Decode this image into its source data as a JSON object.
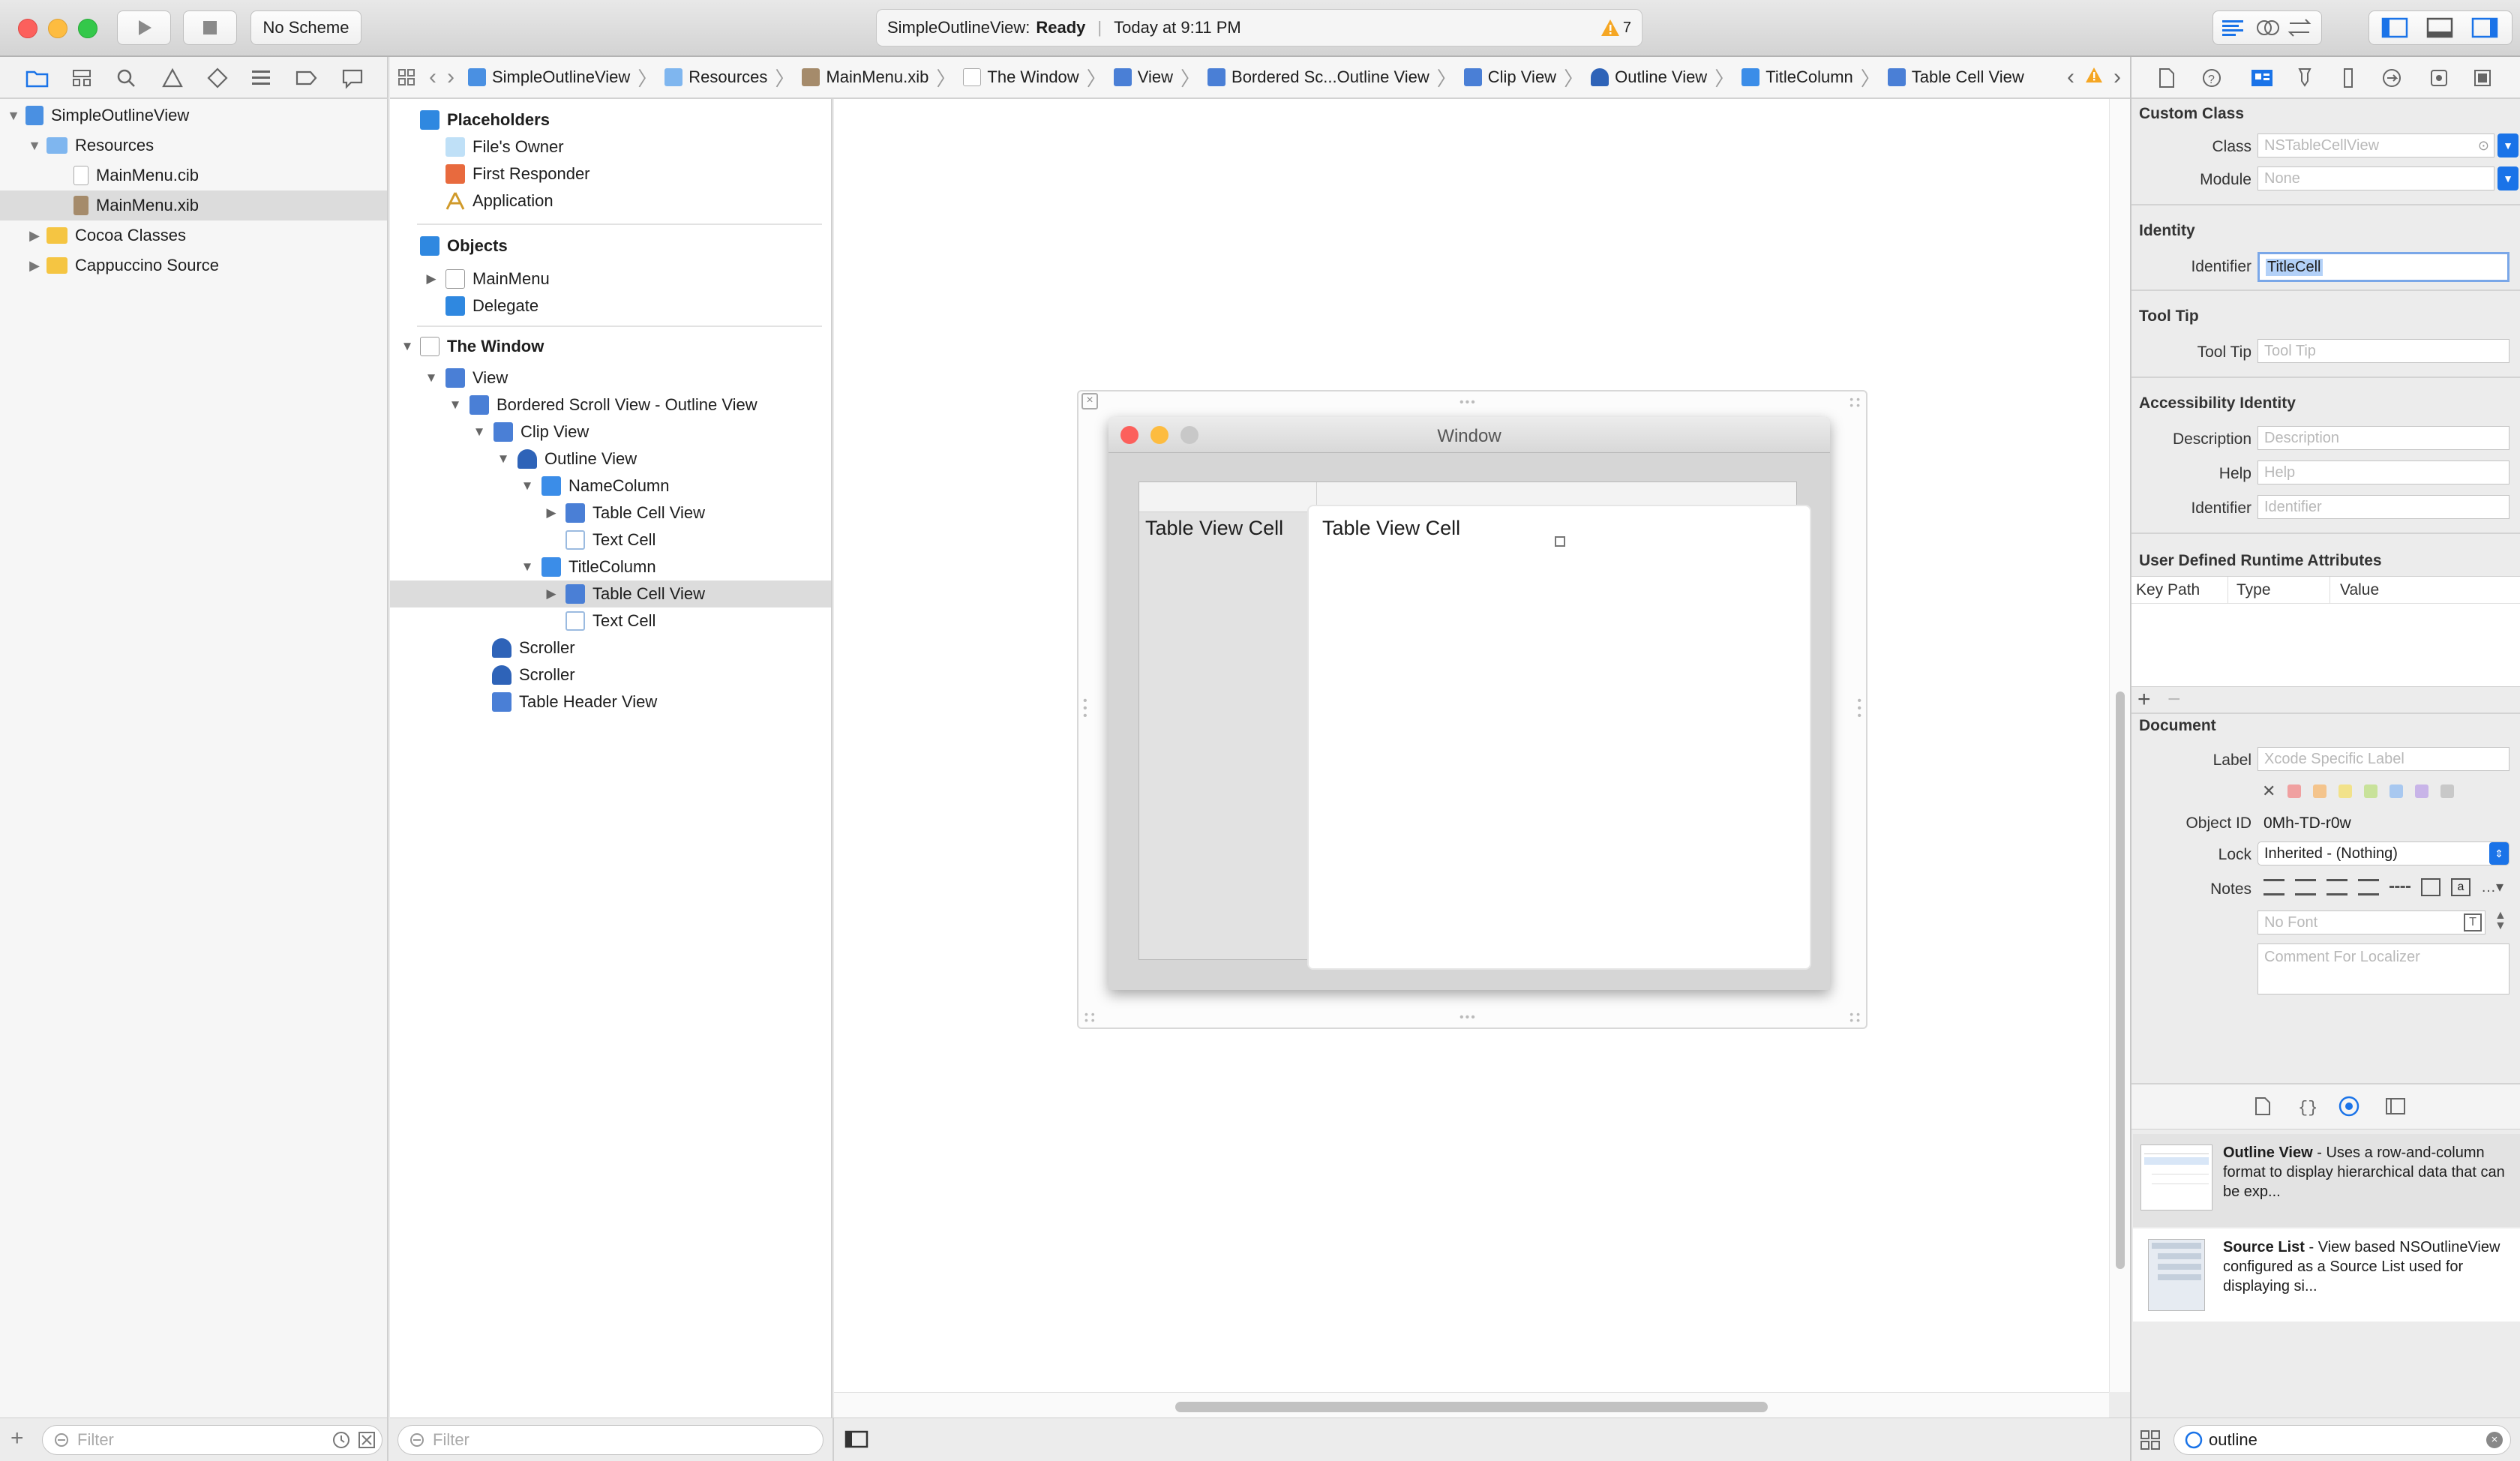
{
  "toolbar": {
    "scheme": "No Scheme",
    "activity_title": "SimpleOutlineView:",
    "activity_status": "Ready",
    "activity_time": "Today at 9:11 PM",
    "warning_count": "7"
  },
  "jumpbar": {
    "crumbs": [
      "SimpleOutlineView",
      "Resources",
      "MainMenu.xib",
      "The Window",
      "View",
      "Bordered Sc...Outline View",
      "Clip View",
      "Outline View",
      "TitleColumn",
      "Table Cell View"
    ]
  },
  "navigator": {
    "items": [
      {
        "label": "SimpleOutlineView"
      },
      {
        "label": "Resources"
      },
      {
        "label": "MainMenu.cib"
      },
      {
        "label": "MainMenu.xib"
      },
      {
        "label": "Cocoa Classes"
      },
      {
        "label": "Cappuccino Source"
      }
    ],
    "filter_placeholder": "Filter"
  },
  "outline": {
    "placeholders_title": "Placeholders",
    "placeholders": [
      "File's Owner",
      "First Responder",
      "Application"
    ],
    "objects_title": "Objects",
    "objects": [
      "MainMenu",
      "Delegate"
    ],
    "window_title": "The Window",
    "tree": [
      "View",
      "Bordered Scroll View - Outline View",
      "Clip View",
      "Outline View",
      "NameColumn",
      "Table Cell View",
      "Text Cell",
      "TitleColumn",
      "Table Cell View",
      "Text Cell",
      "Scroller",
      "Scroller",
      "Table Header View"
    ],
    "filter_placeholder": "Filter"
  },
  "canvas": {
    "window_title": "Window",
    "cell_left": "Table View Cell",
    "cell_right": "Table View Cell"
  },
  "inspector": {
    "custom_class_title": "Custom Class",
    "class_label": "Class",
    "class_placeholder": "NSTableCellView",
    "module_label": "Module",
    "module_placeholder": "None",
    "identity_title": "Identity",
    "identifier_label": "Identifier",
    "identifier_value": "TitleCell",
    "tooltip_title": "Tool Tip",
    "tooltip_label": "Tool Tip",
    "tooltip_placeholder": "Tool Tip",
    "accessibility_title": "Accessibility Identity",
    "description_label": "Description",
    "description_placeholder": "Description",
    "help_label": "Help",
    "help_placeholder": "Help",
    "acc_identifier_label": "Identifier",
    "acc_identifier_placeholder": "Identifier",
    "runtime_title": "User Defined Runtime Attributes",
    "col_keypath": "Key Path",
    "col_type": "Type",
    "col_value": "Value",
    "document_title": "Document",
    "label_label": "Label",
    "label_placeholder": "Xcode Specific Label",
    "objectid_label": "Object ID",
    "objectid_value": "0Mh-TD-r0w",
    "lock_label": "Lock",
    "lock_value": "Inherited - (Nothing)",
    "notes_label": "Notes",
    "font_placeholder": "No Font",
    "comment_placeholder": "Comment For Localizer",
    "label_colors": [
      "#f0a0a0",
      "#f4c48c",
      "#f2e28a",
      "#c8e29a",
      "#a8c8f0",
      "#c8b4e8",
      "#c8c8c8"
    ]
  },
  "library": {
    "items": [
      {
        "title": "Outline View",
        "desc": " - Uses a row-and-column format to display hierarchical data that can be exp..."
      },
      {
        "title": "Source List",
        "desc": " - View based NSOutlineView configured as a Source List used for displaying si..."
      }
    ],
    "search_value": "outline"
  },
  "colors": {
    "accent": "#1a73e8",
    "warning": "#f5a623",
    "folder": "#f5c542",
    "selection": "#dcdcdc"
  }
}
